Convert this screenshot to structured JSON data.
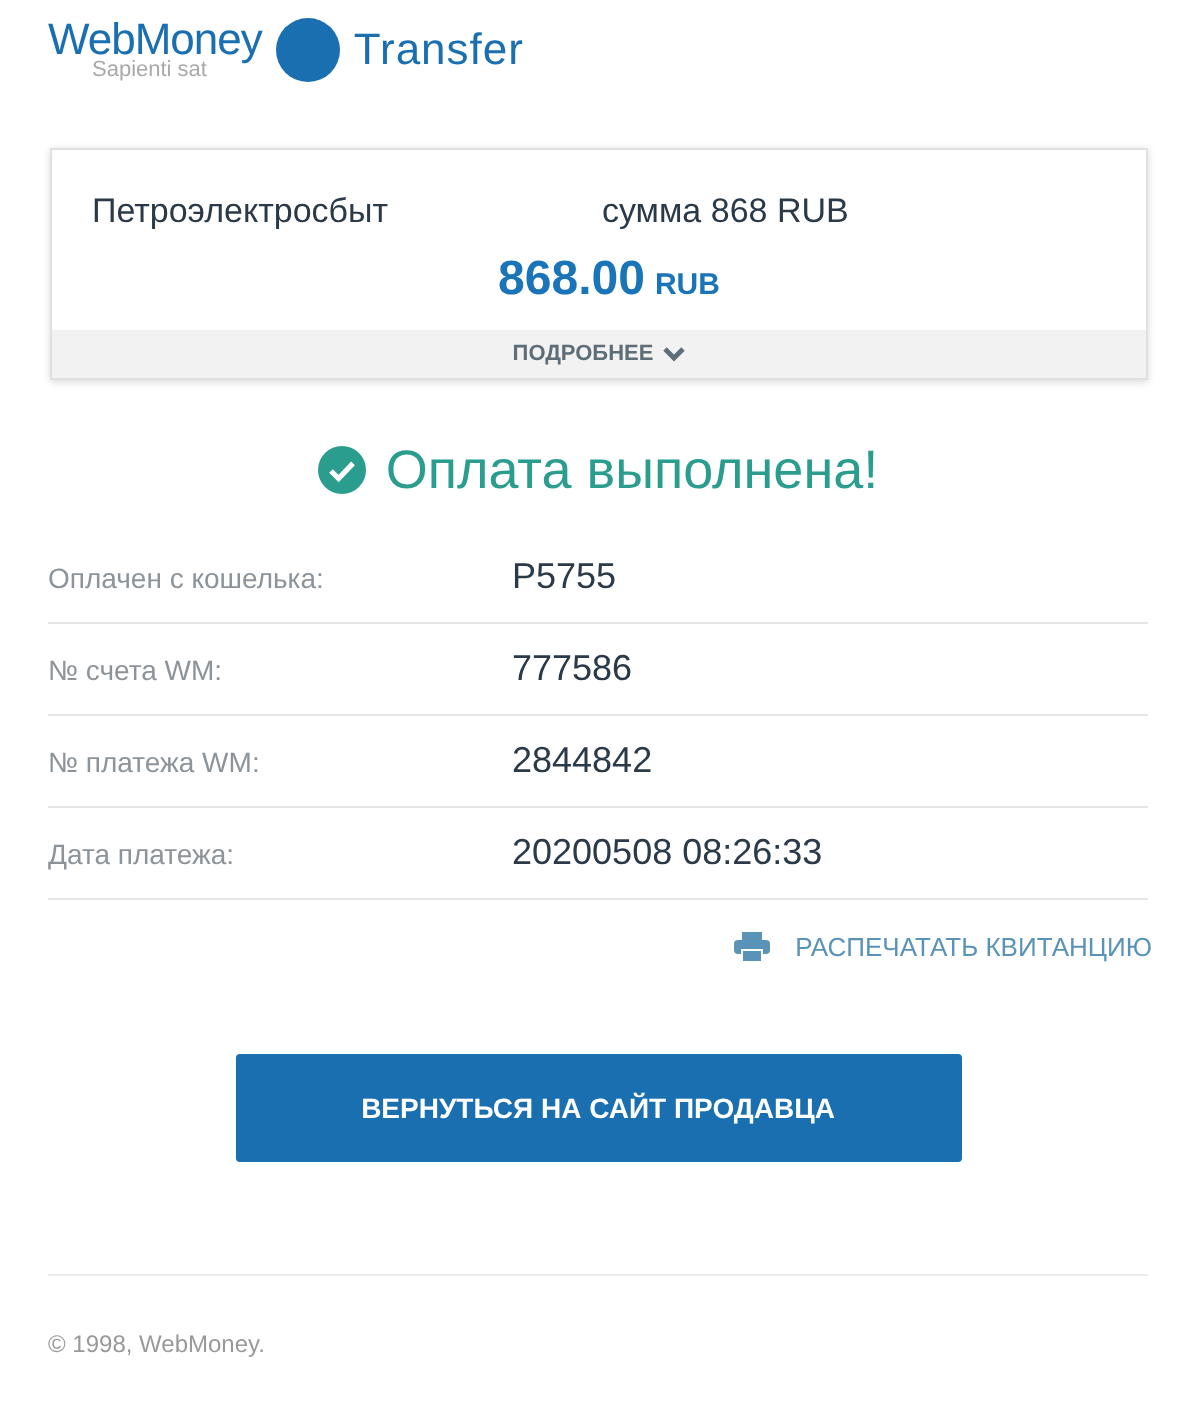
{
  "logo": {
    "brand": "WebMoney",
    "tagline": "Sapienti sat",
    "product": "Transfer"
  },
  "summary": {
    "merchant": "Петроэлектросбыт",
    "description": "сумма 868 RUB",
    "amount": "868.00",
    "currency": "RUB",
    "details_label": "ПОДРОБНЕЕ"
  },
  "status": {
    "message": "Оплата выполнена!"
  },
  "details": [
    {
      "label": "Оплачен с кошелька:",
      "value": "P5755"
    },
    {
      "label": "№ счета WM:",
      "value": "777586"
    },
    {
      "label": "№ платежа WM:",
      "value": "2844842"
    },
    {
      "label": "Дата платежа:",
      "value": "20200508 08:26:33"
    }
  ],
  "print_link": "РАСПЕЧАТАТЬ КВИТАНЦИЮ",
  "return_button": "ВЕРНУТЬСЯ НА САЙТ ПРОДАВЦА",
  "footer": "© 1998, WebMoney."
}
